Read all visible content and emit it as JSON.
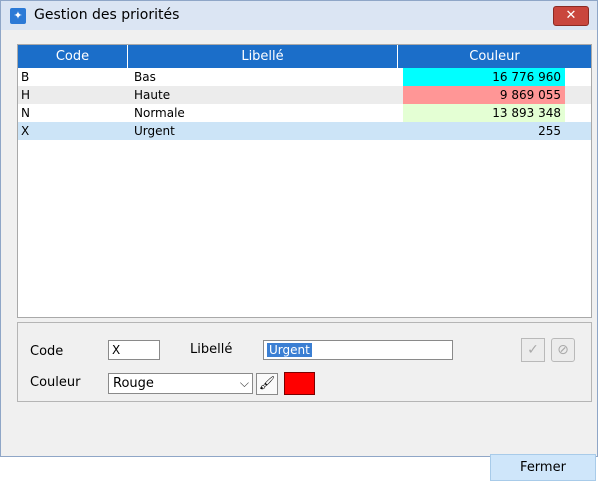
{
  "window": {
    "title": "Gestion des priorités",
    "close_icon": "close-icon"
  },
  "table": {
    "columns": [
      "Code",
      "Libellé",
      "Couleur"
    ],
    "rows": [
      {
        "code": "B",
        "label": "Bas",
        "color": "16 776 960",
        "bg": "#00ffff"
      },
      {
        "code": "H",
        "label": "Haute",
        "color": "9 869 055",
        "bg": "#ff9696"
      },
      {
        "code": "N",
        "label": "Normale",
        "color": "13 893 348",
        "bg": "#e4ffd4"
      },
      {
        "code": "X",
        "label": "Urgent",
        "color": "255",
        "bg": ""
      }
    ],
    "selected_row": 3
  },
  "form": {
    "code_label": "Code",
    "code_value": "X",
    "label_label": "Libellé",
    "label_value": "Urgent",
    "color_label": "Couleur",
    "color_value": "Rouge",
    "swatch_color": "#ff0000",
    "validate_icon": "check-icon",
    "cancel_icon": "cancel-circle-icon",
    "brush_icon": "paint-brush-icon"
  },
  "footer": {
    "close_label": "Fermer"
  },
  "colors": {
    "header": "#1b6ec9",
    "selected_row": "#cce4f7"
  }
}
